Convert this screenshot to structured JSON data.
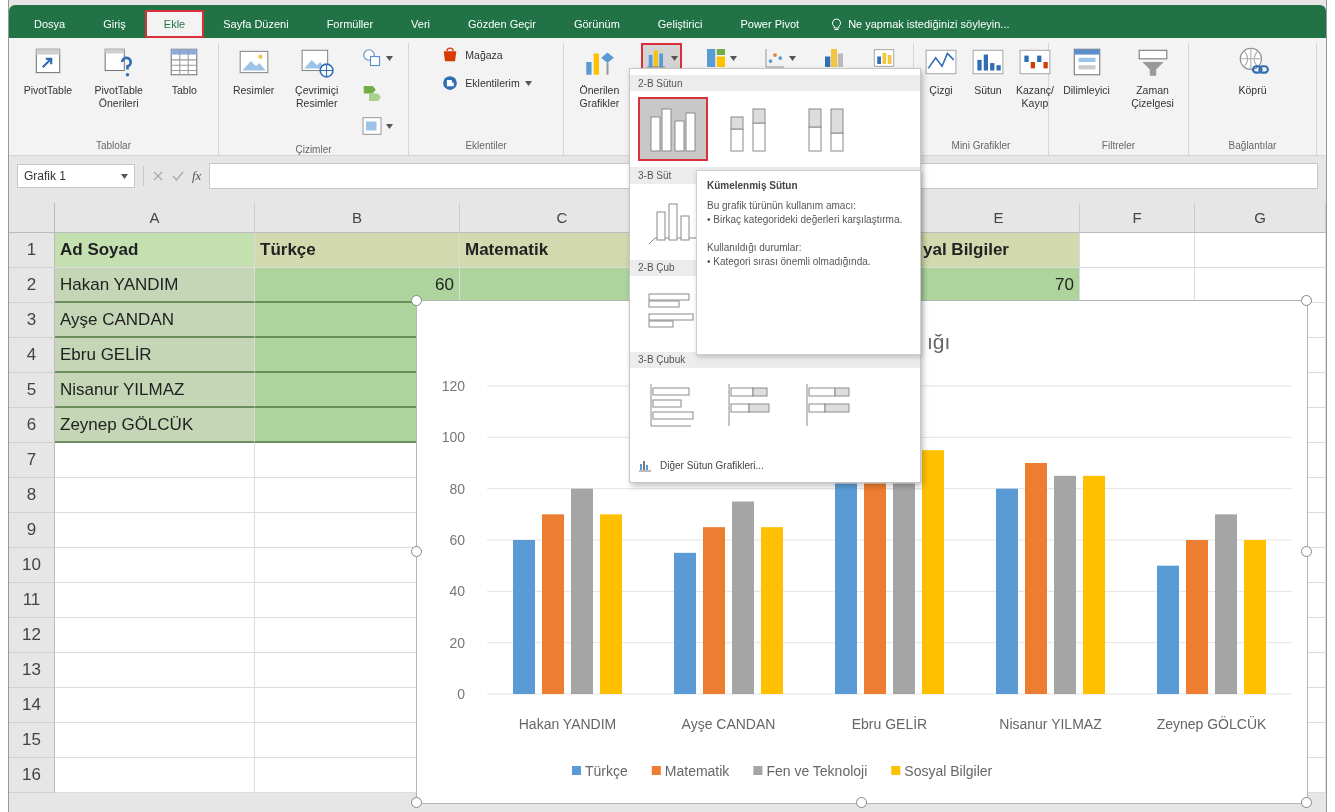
{
  "ribbon_tabs": [
    {
      "label": "Dosya",
      "selected": false,
      "highlighted": false
    },
    {
      "label": "Giriş",
      "selected": false,
      "highlighted": false
    },
    {
      "label": "Ekle",
      "selected": true,
      "highlighted": true
    },
    {
      "label": "Sayfa Düzeni",
      "selected": false,
      "highlighted": false
    },
    {
      "label": "Formüller",
      "selected": false,
      "highlighted": false
    },
    {
      "label": "Veri",
      "selected": false,
      "highlighted": false
    },
    {
      "label": "Gözden Geçir",
      "selected": false,
      "highlighted": false
    },
    {
      "label": "Görünüm",
      "selected": false,
      "highlighted": false
    },
    {
      "label": "Geliştirici",
      "selected": false,
      "highlighted": false
    },
    {
      "label": "Power Pivot",
      "selected": false,
      "highlighted": false
    }
  ],
  "tell_me": "Ne yapmak istediğinizi söyleyin...",
  "ribbon_groups": [
    {
      "label": "Tablolar",
      "items": [
        {
          "kind": "large",
          "label": "PivotTable"
        },
        {
          "kind": "large",
          "label": "PivotTable\nÖnerileri"
        },
        {
          "kind": "large",
          "label": "Tablo"
        }
      ]
    },
    {
      "label": "Çizimler",
      "items": [
        {
          "kind": "large",
          "label": "Resimler"
        },
        {
          "kind": "large",
          "label": "Çevrimiçi\nResimler"
        },
        {
          "kind": "stack",
          "items": [
            {
              "kind": "icon",
              "dropdown": true
            },
            {
              "kind": "icon",
              "dropdown": false
            },
            {
              "kind": "icon",
              "dropdown": true
            }
          ]
        }
      ]
    },
    {
      "label": "Eklentiler",
      "items": [
        {
          "kind": "stack",
          "items": [
            {
              "kind": "small",
              "label": "Mağaza",
              "dropdown": false
            },
            {
              "kind": "small",
              "label": "Eklentilerim",
              "dropdown": true
            }
          ]
        }
      ]
    },
    {
      "items": [
        {
          "kind": "large",
          "label": "Önerilen\nGrafikler"
        },
        {
          "kind": "icon",
          "dropdown": true,
          "highlighted": true
        },
        {
          "kind": "icon",
          "dropdown": true,
          "highlighted": false
        },
        {
          "kind": "icon",
          "dropdown": true,
          "highlighted": false
        },
        {
          "kind": "icon",
          "dropdown": false,
          "highlighted": false
        },
        {
          "kind": "icon",
          "dropdown": false,
          "highlighted": false
        }
      ]
    },
    {
      "label": "Mini Grafikler",
      "items": [
        {
          "kind": "large",
          "label": "Çizgi"
        },
        {
          "kind": "large",
          "label": "Sütun"
        },
        {
          "kind": "large",
          "label": "Kazanç/\nKayıp"
        }
      ]
    },
    {
      "label": "Filtreler",
      "items": [
        {
          "kind": "large",
          "label": "Dilimleyici"
        },
        {
          "kind": "large",
          "label": "Zaman\nÇizelgesi"
        }
      ]
    },
    {
      "label": "Bağlantılar",
      "items": [
        {
          "kind": "large",
          "label": "Köprü"
        }
      ]
    }
  ],
  "formula_bar": {
    "name_box": "Grafik 1",
    "function_label": "fx"
  },
  "columns": [
    "A",
    "B",
    "C",
    null,
    "E",
    "F",
    "G"
  ],
  "rows": [
    {
      "number": "1",
      "kind": "header",
      "cells": [
        {
          "text": "Ad Soyad"
        },
        {
          "text": "Türkçe"
        },
        {
          "text": "Matematik"
        },
        null,
        {
          "text": "yal Bilgiler"
        }
      ]
    },
    {
      "number": "2",
      "kind": "data",
      "cells": [
        {
          "text": "Hakan YANDIM"
        },
        {
          "text": "60",
          "kind": "number"
        },
        null,
        null,
        {
          "text": "70",
          "kind": "number"
        }
      ]
    },
    {
      "number": "3",
      "kind": "data",
      "cells": [
        {
          "text": "Ayşe CANDAN"
        }
      ]
    },
    {
      "number": "4",
      "kind": "data",
      "cells": [
        {
          "text": "Ebru GELİR"
        }
      ]
    },
    {
      "number": "5",
      "kind": "data",
      "cells": [
        {
          "text": "Nisanur YILMAZ"
        }
      ]
    },
    {
      "number": "6",
      "kind": "data",
      "cells": [
        {
          "text": "Zeynep GÖLCÜK"
        }
      ]
    },
    {
      "number": "7",
      "kind": "empty",
      "cells": []
    },
    {
      "number": "8",
      "kind": "empty",
      "cells": []
    },
    {
      "number": "9",
      "kind": "empty",
      "cells": []
    },
    {
      "number": "10",
      "kind": "empty",
      "cells": []
    },
    {
      "number": "11",
      "kind": "empty",
      "cells": []
    },
    {
      "number": "12",
      "kind": "empty",
      "cells": []
    },
    {
      "number": "13",
      "kind": "empty",
      "cells": []
    },
    {
      "number": "14",
      "kind": "empty",
      "cells": []
    },
    {
      "number": "15",
      "kind": "empty",
      "cells": []
    },
    {
      "number": "16",
      "kind": "empty",
      "cells": []
    }
  ],
  "chart": {
    "chart_data": {
      "type": "bar",
      "title": "ığı",
      "categories": [
        "Hakan YANDIM",
        "Ayşe CANDAN",
        "Ebru GELİR",
        "Nisanur YILMAZ",
        "Zeynep GÖLCÜK"
      ],
      "series": [
        {
          "name": "Türkçe",
          "color": "#5b9bd5",
          "values": [
            60,
            55,
            82,
            80,
            50
          ]
        },
        {
          "name": "Matematik",
          "color": "#ed7d31",
          "values": [
            70,
            65,
            82,
            90,
            60
          ]
        },
        {
          "name": "Fen ve Teknoloji",
          "color": "#a5a5a5",
          "values": [
            80,
            75,
            82,
            85,
            70
          ]
        },
        {
          "name": "Sosyal Bilgiler",
          "color": "#ffc000",
          "values": [
            70,
            65,
            95,
            85,
            60
          ]
        }
      ],
      "ylim": [
        0,
        120
      ],
      "yticks": [
        0,
        20,
        40,
        60,
        80,
        100,
        120
      ],
      "grid": true,
      "legend": true
    }
  },
  "chart_menu": {
    "sections": [
      {
        "title": "2-B Sütun",
        "items": [
          {
            "selected": true,
            "highlighted": true
          },
          {
            "selected": false,
            "highlighted": false
          },
          {
            "selected": false,
            "highlighted": false
          }
        ]
      },
      {
        "title": "3-B Süt",
        "items": [
          {
            "selected": false,
            "highlighted": false
          }
        ]
      },
      {
        "title": "2-B Çub",
        "items": [
          {
            "selected": false,
            "highlighted": false
          }
        ]
      },
      {
        "title": "3-B Çubuk",
        "items": [
          {
            "selected": false,
            "highlighted": false
          },
          {
            "selected": false,
            "highlighted": false
          },
          {
            "selected": false,
            "highlighted": false
          }
        ]
      }
    ],
    "footer": "Diğer Sütun Grafikleri..."
  },
  "tooltip": {
    "title": "Kümelenmiş Sütun",
    "paragraphs": [
      [
        "Bu grafik türünün kullanım amacı:",
        "• Birkaç kategorideki değerleri karşılaştırma."
      ],
      [
        "Kullanıldığı durumlar:",
        "• Kategori sırası önemli olmadığında."
      ]
    ]
  }
}
